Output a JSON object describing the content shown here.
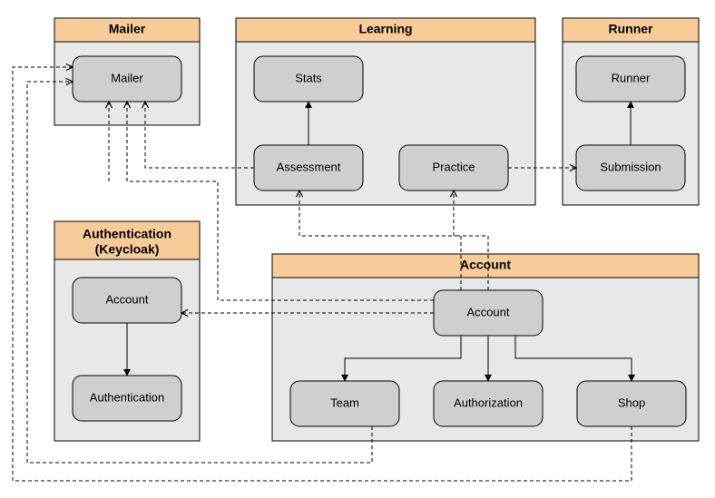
{
  "groups": {
    "mailer": {
      "title": "Mailer"
    },
    "learning": {
      "title": "Learning"
    },
    "runner": {
      "title": "Runner"
    },
    "auth": {
      "title_line1": "Authentication",
      "title_line2": "(Keycloak)"
    },
    "account": {
      "title": "Account"
    }
  },
  "nodes": {
    "mailer_mailer": "Mailer",
    "learning_stats": "Stats",
    "learning_assessment": "Assessment",
    "learning_practice": "Practice",
    "runner_runner": "Runner",
    "runner_submission": "Submission",
    "auth_account": "Account",
    "auth_authentication": "Authentication",
    "account_account": "Account",
    "account_team": "Team",
    "account_authorization": "Authorization",
    "account_shop": "Shop"
  },
  "edges": [
    {
      "from": "learning_assessment",
      "to": "learning_stats",
      "style": "solid"
    },
    {
      "from": "runner_submission",
      "to": "runner_runner",
      "style": "solid"
    },
    {
      "from": "auth_account",
      "to": "auth_authentication",
      "style": "solid"
    },
    {
      "from": "account_account",
      "to": "account_team",
      "style": "solid"
    },
    {
      "from": "account_account",
      "to": "account_authorization",
      "style": "solid"
    },
    {
      "from": "account_account",
      "to": "account_shop",
      "style": "solid"
    },
    {
      "from": "learning_assessment",
      "to": "mailer_mailer",
      "style": "dashed"
    },
    {
      "from": "learning_practice",
      "to": "runner_submission",
      "style": "dashed"
    },
    {
      "from": "account_account",
      "to": "learning_assessment",
      "style": "dashed"
    },
    {
      "from": "account_account",
      "to": "learning_practice",
      "style": "dashed"
    },
    {
      "from": "account_account",
      "to": "auth_account",
      "style": "dashed"
    },
    {
      "from": "account_account",
      "to": "mailer_mailer",
      "style": "dashed"
    },
    {
      "from": "account_team",
      "to": "mailer_mailer",
      "style": "dashed"
    },
    {
      "from": "account_shop",
      "to": "mailer_mailer",
      "style": "dashed"
    }
  ]
}
